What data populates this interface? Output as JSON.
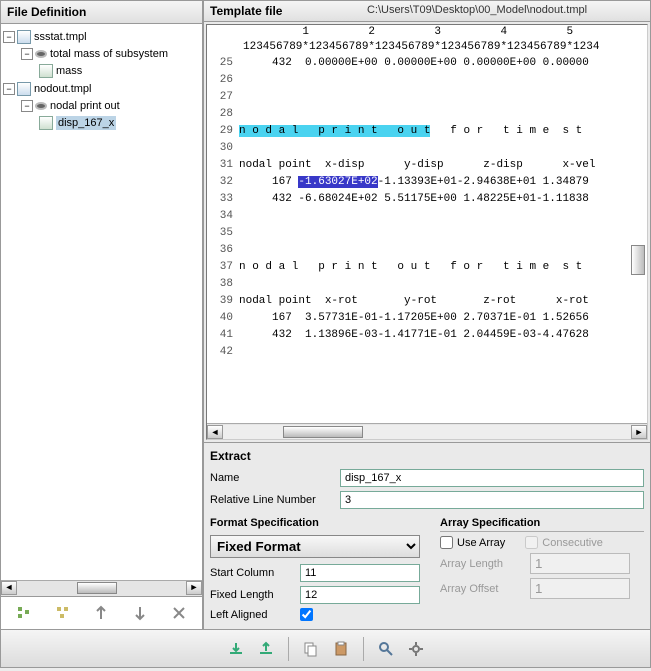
{
  "left": {
    "header": "File Definition",
    "tree": [
      {
        "label": "ssstat.tmpl"
      },
      {
        "label": "total mass of subsystem"
      },
      {
        "label": "mass"
      },
      {
        "label": "nodout.tmpl"
      },
      {
        "label": "nodal print out"
      },
      {
        "label": "disp_167_x"
      }
    ]
  },
  "template": {
    "header_title": "Template file",
    "path": "C:\\Users\\T09\\Desktop\\00_Model\\nodout.tmpl",
    "ruler1": "         1         2         3         4         5",
    "ruler2": "123456789*123456789*123456789*123456789*123456789*1234",
    "rows": [
      {
        "n": 25,
        "t": "     432  0.00000E+00 0.00000E+00 0.00000E+00 0.00000"
      },
      {
        "n": 26,
        "t": ""
      },
      {
        "n": 27,
        "t": ""
      },
      {
        "n": 28,
        "t": ""
      },
      {
        "n": 29,
        "t": "",
        "cyan": "n o d a l   p r i n t   o u t",
        "rest": "   f o r   t i m e  s t"
      },
      {
        "n": 30,
        "t": ""
      },
      {
        "n": 31,
        "t": "nodal point  x-disp      y-disp      z-disp      x-vel"
      },
      {
        "n": 32,
        "pre": "     167 ",
        "blue": "-1.63027E+02",
        "post": "-1.13393E+01-2.94638E+01 1.34879"
      },
      {
        "n": 33,
        "t": "     432 -6.68024E+02 5.51175E+00 1.48225E+01-1.11838"
      },
      {
        "n": 34,
        "t": ""
      },
      {
        "n": 35,
        "t": ""
      },
      {
        "n": 36,
        "t": ""
      },
      {
        "n": 37,
        "t": "n o d a l   p r i n t   o u t   f o r   t i m e  s t"
      },
      {
        "n": 38,
        "t": ""
      },
      {
        "n": 39,
        "t": "nodal point  x-rot       y-rot       z-rot      x-rot"
      },
      {
        "n": 40,
        "t": "     167  3.57731E-01-1.17205E+00 2.70371E-01 1.52656"
      },
      {
        "n": 41,
        "t": "     432  1.13896E-03-1.41771E-01 2.04459E-03-4.47628"
      },
      {
        "n": 42,
        "t": ""
      }
    ]
  },
  "extract": {
    "header": "Extract",
    "name_label": "Name",
    "name_value": "disp_167_x",
    "relline_label": "Relative Line Number",
    "relline_value": "3",
    "format_spec_title": "Format Specification",
    "format_value": "Fixed Format",
    "start_col_label": "Start Column",
    "start_col_value": "11",
    "fixed_len_label": "Fixed Length",
    "fixed_len_value": "12",
    "left_aligned_label": "Left Aligned",
    "array_spec_title": "Array Specification",
    "use_array_label": "Use Array",
    "consecutive_label": "Consecutive",
    "array_len_label": "Array Length",
    "array_len_value": "1",
    "array_off_label": "Array Offset",
    "array_off_value": "1"
  }
}
